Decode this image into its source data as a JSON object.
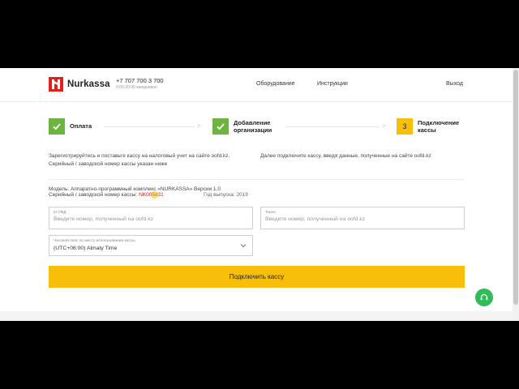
{
  "header": {
    "brand": "Nurkassa",
    "phone": "+7 707 700 3 700",
    "hours": "9:00-20:00 ежедневно",
    "nav": {
      "equipment": "Оборудование",
      "instructions": "Инструкции",
      "exit": "Выход"
    }
  },
  "steps": [
    {
      "label": "Оплата",
      "state": "done"
    },
    {
      "label_line1": "Добавление",
      "label_line2": "организации",
      "state": "done"
    },
    {
      "number": "3",
      "label_line1": "Подключение",
      "label_line2": "кассы",
      "state": "active"
    }
  ],
  "instructions": {
    "left": "Зарегистрируйтесь и поставьте кассу на налоговый учет на сайте oofd.kz. Серийный / заводской номер кассы указан ниже",
    "right": "Далее подключите кассу, введя данные, полученные на сайте oofd.kz"
  },
  "device": {
    "model": "Модель: Аппаратно-программный комплекс «NURKASSA» Версии 1.0",
    "serial_label": "Серийный / заводской номер кассы:",
    "serial_value": "NK005431",
    "year": "Год выпуска: 2019"
  },
  "form": {
    "ofd_id": {
      "label": "id ОФД",
      "placeholder": "Введите номер, полученный на oofd.kz",
      "value": ""
    },
    "token": {
      "label": "Токен",
      "placeholder": "Введите номер, полученный на oofd.kz",
      "value": ""
    },
    "timezone": {
      "label": "Часовой пояс по месту использования кассы",
      "value": "(UTC+06:00) Almaty Time"
    },
    "submit_label": "Подключить кассу"
  },
  "colors": {
    "accent": "#f7bf0a",
    "done": "#6cb33f",
    "brand": "#e0201b",
    "support": "#2fbd59"
  },
  "icons": {
    "support": "headset-icon",
    "step_done": "check-icon",
    "select": "chevron-down-icon"
  }
}
